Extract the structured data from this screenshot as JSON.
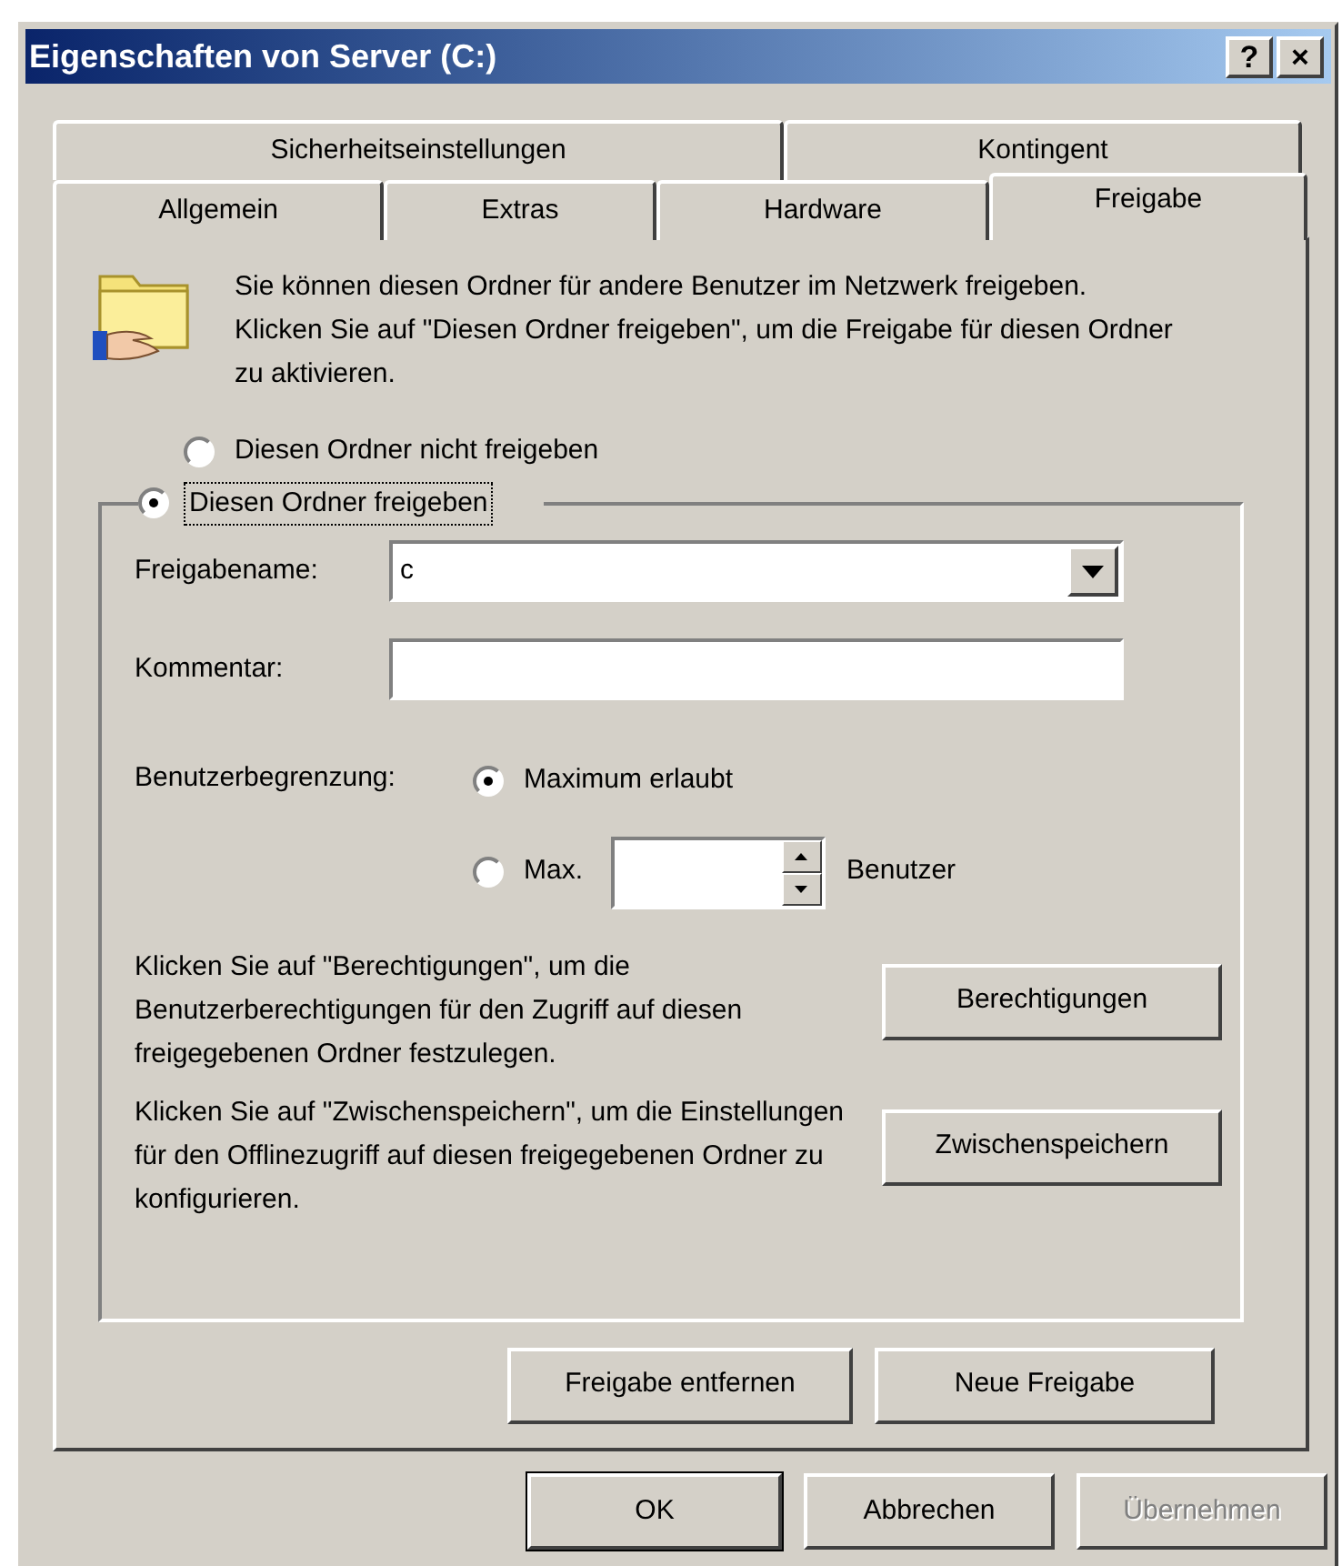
{
  "window": {
    "title": "Eigenschaften von Server (C:)",
    "title_buttons": [
      "?",
      "×"
    ]
  },
  "tab_rows": [
    [
      {
        "label": "Sicherheitseinstellungen",
        "selected": false
      },
      {
        "label": "Kontingent",
        "selected": false
      }
    ],
    [
      {
        "label": "Allgemein",
        "selected": false
      },
      {
        "label": "Extras",
        "selected": false
      },
      {
        "label": "Hardware",
        "selected": false
      },
      {
        "label": "Freigabe",
        "selected": true
      }
    ]
  ],
  "intro": "Sie können diesen Ordner für andere Benutzer im Netzwerk freigeben. Klicken Sie auf \"Diesen Ordner freigeben\", um die Freigabe für diesen Ordner zu aktivieren.",
  "share_options": [
    {
      "label": "Diesen Ordner nicht freigeben",
      "selected": false,
      "focused": false
    },
    {
      "label": "Diesen Ordner freigeben",
      "selected": true,
      "focused": true
    }
  ],
  "share_name": {
    "label": "Freigabename:",
    "value": "c"
  },
  "comment": {
    "label": "Kommentar:"
  },
  "user_limit": {
    "label": "Benutzerbegrenzung:",
    "options": [
      {
        "label": "Maximum erlaubt",
        "selected": true
      },
      {
        "label": "Max.",
        "selected": false
      }
    ],
    "unit": "Benutzer"
  },
  "permissions": {
    "text": "Klicken Sie auf \"Berechtigungen\", um die Benutzerberechtigungen für den Zugriff auf diesen freigegebenen Ordner festzulegen.",
    "button": "Berechtigungen"
  },
  "caching": {
    "text": "Klicken Sie auf \"Zwischenspeichern\", um die Einstellungen für den Offlinezugriff auf diesen freigegebenen Ordner zu konfigurieren.",
    "button": "Zwischenspeichern"
  },
  "share_buttons": [
    "Freigabe entfernen",
    "Neue Freigabe"
  ],
  "buttons": [
    {
      "label": "OK",
      "default": true,
      "disabled": false
    },
    {
      "label": "Abbrechen",
      "default": false,
      "disabled": false
    },
    {
      "label": "Übernehmen",
      "default": false,
      "disabled": true
    }
  ]
}
